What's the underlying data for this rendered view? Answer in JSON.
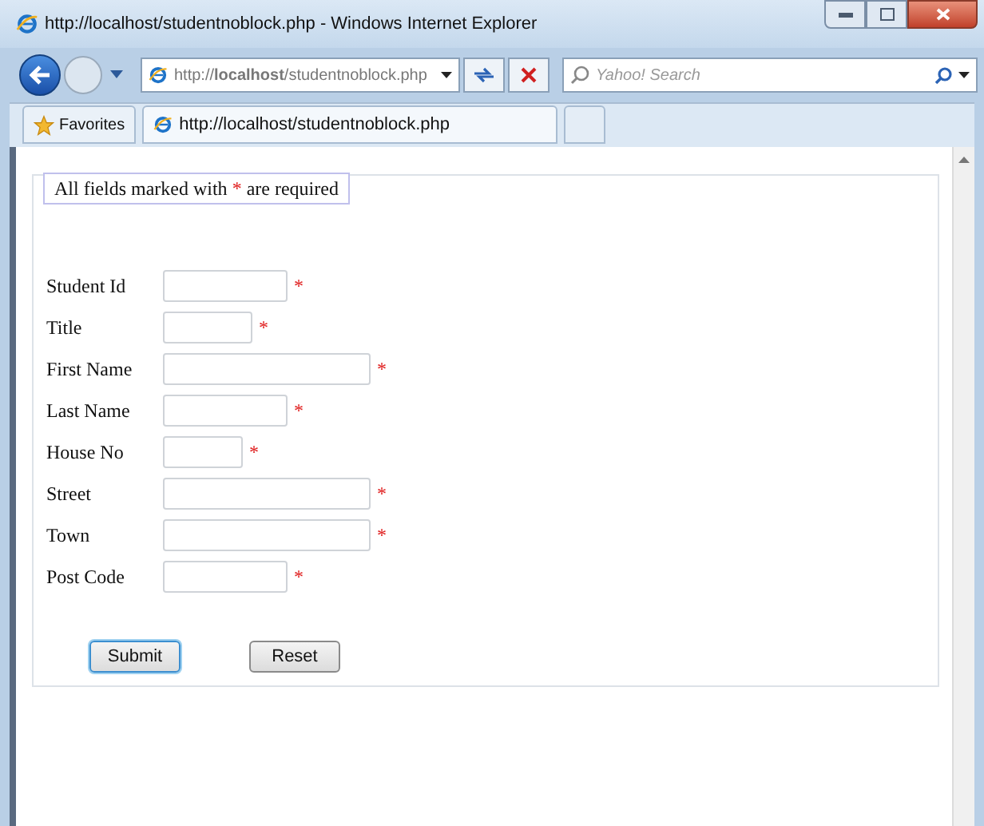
{
  "window": {
    "title": "http://localhost/studentnoblock.php - Windows Internet Explorer"
  },
  "address_bar": {
    "value": "http://**localhost**/studentnoblock.php"
  },
  "search": {
    "placeholder": "Yahoo! Search"
  },
  "favorites_button": {
    "label": "Favorites"
  },
  "tabs": [
    {
      "label": "http://localhost/studentnoblock.php",
      "selected": true
    }
  ],
  "form": {
    "legend": {
      "before": "All fields marked with",
      "mark": "*",
      "after": "are required"
    },
    "fields": [
      {
        "label": "Student Id",
        "required": true
      },
      {
        "label": "Title",
        "required": true
      },
      {
        "label": "First Name",
        "required": true
      },
      {
        "label": "Last Name",
        "required": true
      },
      {
        "label": "House No",
        "required": true
      },
      {
        "label": "Street",
        "required": true
      },
      {
        "label": "Town",
        "required": true
      },
      {
        "label": "Post Code",
        "required": true
      }
    ],
    "buttons": [
      {
        "label": "Submit",
        "selected": true
      },
      {
        "label": "Reset",
        "selected": false
      }
    ]
  }
}
